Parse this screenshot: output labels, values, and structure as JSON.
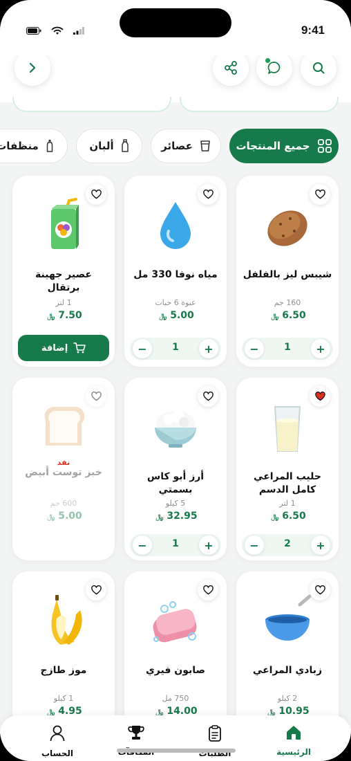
{
  "status": {
    "time": "9:41"
  },
  "categories": [
    {
      "label": "جميع المنتجات",
      "icon": "grid-icon",
      "active": true
    },
    {
      "label": "عصائر",
      "icon": "cup-icon",
      "active": false
    },
    {
      "label": "ألبان",
      "icon": "bottle-icon",
      "active": false
    },
    {
      "label": "منظفات",
      "icon": "spray-bottle-icon",
      "active": false
    }
  ],
  "products": [
    {
      "name": "شيبس ليز بالفلفل",
      "unit": "160 جم",
      "price": "6.50",
      "currency": "﷼",
      "qty": "1",
      "favorite": false,
      "image": "potato",
      "state": "stepper"
    },
    {
      "name": "مياه نوفا 330 مل",
      "unit": "عبوة 6 حبات",
      "price": "5.00",
      "currency": "﷼",
      "qty": "1",
      "favorite": false,
      "image": "water-drop",
      "state": "stepper"
    },
    {
      "name": "عصير جهينة برتقال",
      "unit": "1 لتر",
      "price": "7.50",
      "currency": "﷼",
      "favorite": false,
      "image": "juice-box",
      "state": "add",
      "add_label": "إضافة"
    },
    {
      "name": "حليب المراعي كامل الدسم",
      "unit": "1 لتر",
      "price": "6.50",
      "currency": "﷼",
      "qty": "2",
      "favorite": true,
      "image": "milk-glass",
      "state": "stepper"
    },
    {
      "name": "أرز أبو كاس بسمتي",
      "unit": "5 كيلو",
      "price": "32.95",
      "currency": "﷼",
      "qty": "1",
      "favorite": false,
      "image": "rice-bowl",
      "state": "stepper"
    },
    {
      "name": "خبز توست أبيض",
      "unit": "600 جم",
      "price": "5.00",
      "currency": "﷼",
      "favorite": false,
      "image": "bread",
      "state": "out_of_stock",
      "oos_label": "نفد"
    },
    {
      "name": "زبادي المراعي",
      "unit": "2 كيلو",
      "price": "10.95",
      "currency": "﷼",
      "favorite": false,
      "image": "yogurt-bowl",
      "state": "stepper"
    },
    {
      "name": "صابون فيري",
      "unit": "750 مل",
      "price": "14.00",
      "currency": "﷼",
      "favorite": false,
      "image": "soap",
      "state": "stepper"
    },
    {
      "name": "موز طازج",
      "unit": "1 كيلو",
      "price": "4.95",
      "currency": "﷼",
      "favorite": false,
      "image": "banana",
      "state": "stepper"
    }
  ],
  "nav": [
    {
      "label": "الرئيسية",
      "icon": "home-icon",
      "active": true
    },
    {
      "label": "الطلبات",
      "icon": "clipboard-icon",
      "active": false
    },
    {
      "label": "المكافآت",
      "icon": "trophy-icon",
      "active": false
    },
    {
      "label": "الحساب",
      "icon": "user-icon",
      "active": false
    }
  ],
  "colors": {
    "primary": "#177A4B",
    "favorite": "#D93025"
  }
}
